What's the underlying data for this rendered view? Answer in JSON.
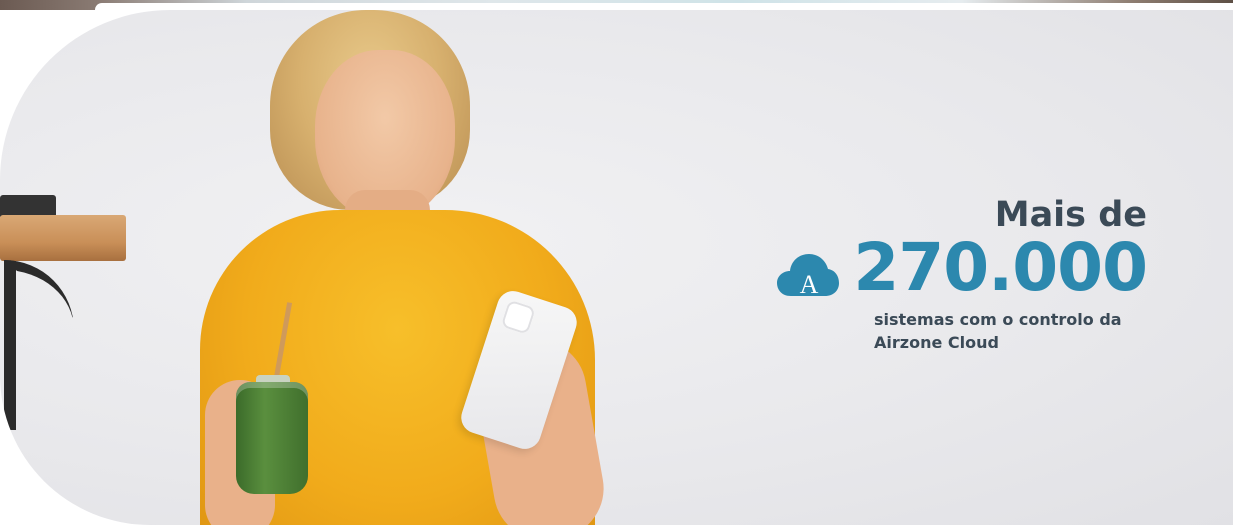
{
  "stat": {
    "prefix": "Mais de",
    "number": "270.000",
    "description": "sistemas com o controlo da Airzone Cloud"
  },
  "icons": {
    "cloud": "cloud-icon",
    "cloud_letter": "A"
  },
  "colors": {
    "accent": "#2c88ae",
    "text_dark": "#3b4a57",
    "shirt": "#f1ab1b"
  }
}
